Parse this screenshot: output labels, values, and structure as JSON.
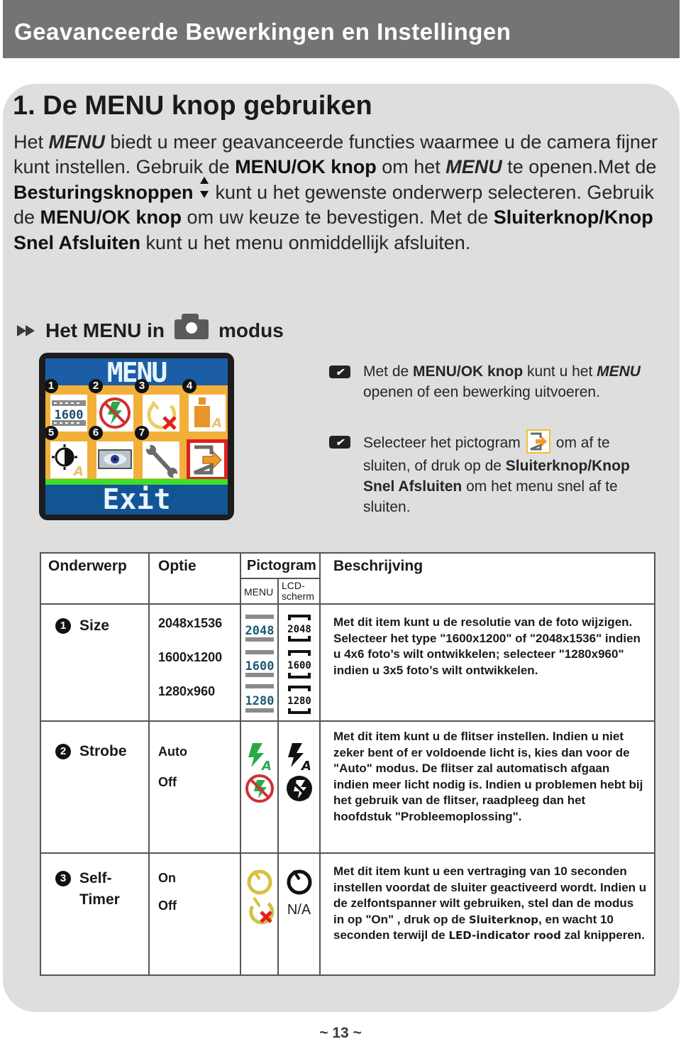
{
  "header": {
    "title": "Geavanceerde Bewerkingen en Instellingen"
  },
  "section": {
    "title": "1. De MENU knop gebruiken",
    "intro": {
      "p1_pre": "Het ",
      "p1_menu": "MENU",
      "p1_post": " biedt u meer geavanceerde functies waarmee u de camera fijner kunt instellen. Gebruik de ",
      "p1_btn": "MENU/OK knop",
      "p1_mid": " om het ",
      "p1_menu2": "MENU",
      "p1_te": " te openen.Met de ",
      "p1_nav": "Besturingsknoppen",
      "p1_after_nav": " kunt u het gewenste onderwerp selecteren. Gebruik de ",
      "p1_btn2": "MENU/OK knop",
      "p1_confirm": " om uw keuze te bevestigen. Met de ",
      "p1_shutter": "Sluiterknop/Knop Snel Afsluiten",
      "p1_end": " kunt u het menu onmiddellijk afsluiten."
    }
  },
  "submenu": {
    "heading_pre": "Het MENU in",
    "heading_post": "modus",
    "camera_icon": "camera-icon"
  },
  "lcd": {
    "title": "MENU",
    "footer": "Exit",
    "items": [
      {
        "num": "1",
        "icon": "resolution-1600-icon",
        "label": "1600"
      },
      {
        "num": "2",
        "icon": "flash-off-icon"
      },
      {
        "num": "3",
        "icon": "self-timer-off-icon"
      },
      {
        "num": "4",
        "icon": "auto-scene-icon"
      },
      {
        "num": "5",
        "icon": "exposure-auto-icon"
      },
      {
        "num": "6",
        "icon": "preview-eye-icon"
      },
      {
        "num": "7",
        "icon": "setup-wrench-icon"
      },
      {
        "num": "",
        "icon": "exit-icon",
        "selected": true
      }
    ]
  },
  "notes": [
    {
      "pre": "Met de ",
      "bold": "MENU/OK knop",
      "mid": " kunt u het ",
      "menu": "MENU",
      "post": " openen of een bewerking uitvoeren."
    },
    {
      "pre": "Selecteer het pictogram",
      "mid": "om af te sluiten, of druk op de ",
      "bold": "Sluiterknop/Knop Snel Afsluiten",
      "post": " om het menu snel af te sluiten."
    }
  ],
  "table": {
    "headers": {
      "topic": "Onderwerp",
      "option": "Optie",
      "icon": "Pictogram",
      "icon_menu": "MENU",
      "icon_lcd": "LCD-scherm",
      "desc": "Beschrijving"
    },
    "rows": [
      {
        "num": "1",
        "topic": "Size",
        "options": [
          "2048x1536",
          "1600x1200",
          "1280x960"
        ],
        "menu_icons": [
          "2048",
          "1600",
          "1280"
        ],
        "lcd_icons": [
          "2048",
          "1600",
          "1280"
        ],
        "description": "Met dit item kunt u de resolutie van de foto wijzigen. Selecteer het type \"1600x1200\" of \"2048x1536\" indien u 4x6 foto’s wilt ontwikkelen; selecteer \"1280x960\" indien u 3x5 foto’s wilt ontwikkelen."
      },
      {
        "num": "2",
        "topic": "Strobe",
        "options": [
          "Auto",
          "Off"
        ],
        "description": "Met dit item kunt u de flitser instellen. Indien u niet zeker bent of er voldoende licht is, kies dan voor de \"Auto\" modus. De flitser zal automatisch afgaan indien meer licht nodig is. Indien u problemen hebt bij het gebruik van de flitser, raadpleeg dan het hoofdstuk \"Probleemoplossing\"."
      },
      {
        "num": "3",
        "topic_line1": "Self-",
        "topic_line2": "Timer",
        "options": [
          "On",
          "Off"
        ],
        "lcd_na": "N/A",
        "description_pre": "Met dit item kunt u een vertraging van 10 seconden instellen voordat de sluiter geactiveerd wordt. Indien u de zelfontspanner wilt gebruiken, stel dan de modus in op \"On\" , druk op de ",
        "description_b1": "Sluiterknop",
        "description_mid": ", en wacht 10 seconden terwijl de ",
        "description_b2": "LED-indicator rood",
        "description_end": " zal knipperen."
      }
    ]
  },
  "footer": {
    "page": "~ 13 ~"
  },
  "colors": {
    "header_bg": "#767472",
    "panel_bg": "#dedede",
    "lcd_blue": "#1b5ea6",
    "lcd_orange": "#f2b03a",
    "lcd_green": "#3ce02a",
    "select_red": "#e02020",
    "flash_green": "#2aa84a"
  }
}
